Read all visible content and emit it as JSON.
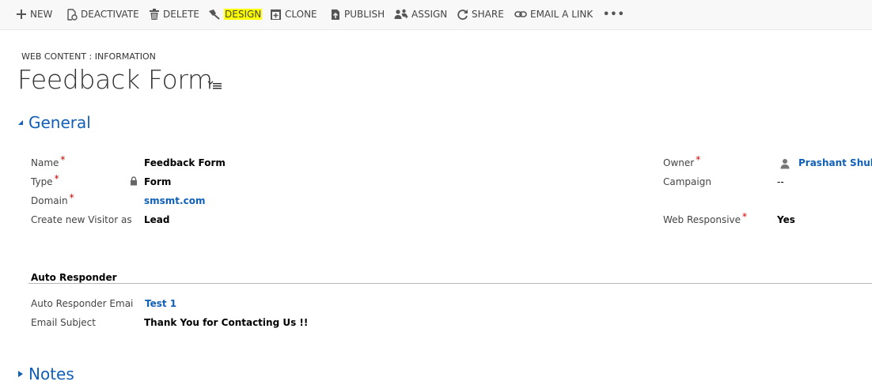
{
  "toolbar": {
    "new": "NEW",
    "deactivate": "DEACTIVATE",
    "delete": "DELETE",
    "design": "DESIGN",
    "clone": "CLONE",
    "publish": "PUBLISH",
    "assign": "ASSIGN",
    "share": "SHARE",
    "email_link": "EMAIL A LINK",
    "more": "•••"
  },
  "header": {
    "entity": "WEB CONTENT : INFORMATION",
    "title": "Feedback Form"
  },
  "general": {
    "heading": "General",
    "fields": {
      "name": {
        "label": "Name",
        "value": "Feedback Form",
        "required": "*"
      },
      "type": {
        "label": "Type",
        "value": "Form",
        "required": "*"
      },
      "domain": {
        "label": "Domain",
        "value": "smsmt.com",
        "required": "*"
      },
      "visitor": {
        "label": "Create new Visitor as",
        "value": "Lead"
      },
      "owner": {
        "label": "Owner",
        "value": "Prashant Shukla",
        "required": "*"
      },
      "campaign": {
        "label": "Campaign",
        "value": "--"
      },
      "responsive": {
        "label": "Web Responsive",
        "value": "Yes",
        "required": "*"
      }
    }
  },
  "auto_responder": {
    "heading": "Auto Responder",
    "email": {
      "label": "Auto Responder Emai",
      "value": "Test 1"
    },
    "subject": {
      "label": "Email Subject",
      "value": "Thank You for Contacting Us !!"
    }
  },
  "notes": {
    "heading": "Notes"
  },
  "colors": {
    "link": "#1160b7",
    "required": "#d60000",
    "highlight": "#ffff00"
  },
  "icons": [
    "plus-icon",
    "deactivate-icon",
    "trash-icon",
    "design-icon",
    "clone-icon",
    "publish-icon",
    "assign-icon",
    "share-icon",
    "link-icon",
    "lock-icon",
    "person-icon",
    "list-menu-icon",
    "triangle-expanded-icon",
    "triangle-collapsed-icon"
  ]
}
